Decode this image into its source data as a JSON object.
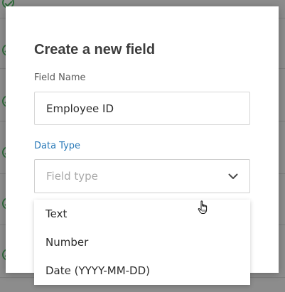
{
  "modal": {
    "title": "Create a new field",
    "field_name": {
      "label": "Field Name",
      "value": "Employee ID"
    },
    "data_type": {
      "label": "Data Type",
      "placeholder": "Field type",
      "icon": "chevron-down-icon",
      "options": [
        "Text",
        "Number",
        "Date (YYYY-MM-DD)"
      ]
    }
  },
  "colors": {
    "accent": "#2a7ab8",
    "check": "#2f6a3a"
  },
  "cursor": "hand-pointer-icon"
}
